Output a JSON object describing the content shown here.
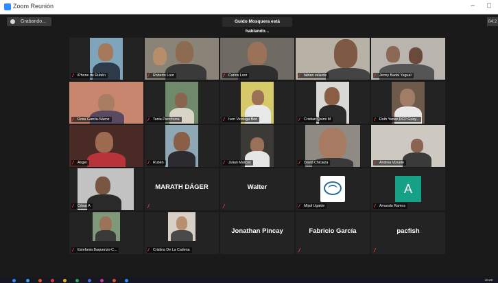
{
  "window": {
    "title": "Zoom Reunión",
    "minimize": "–",
    "maximize": "□"
  },
  "top": {
    "recording": "Grabando...",
    "speaking": "Guido Mosquera está hablando...",
    "timer": "04:2"
  },
  "participants": [
    {
      "name": "iPhone de Rubén",
      "label": ""
    },
    {
      "name": "Roberto Loor",
      "label": ""
    },
    {
      "name": "Carlos Loor",
      "label": ""
    },
    {
      "name": "fabian velarde",
      "label": ""
    },
    {
      "name": "Jenny Badal Yagual",
      "label": ""
    },
    {
      "name": "Rosa García-Sáenz",
      "label": ""
    },
    {
      "name": "Tania Parrchona",
      "label": ""
    },
    {
      "name": "Ivon Verduga Boo",
      "label": ""
    },
    {
      "name": "Cristian Quimi M",
      "label": ""
    },
    {
      "name": "Ruth Yanez DCP Guay...",
      "label": ""
    },
    {
      "name": "Angel",
      "label": ""
    },
    {
      "name": "Rubén",
      "label": ""
    },
    {
      "name": "Julian Marcos",
      "label": ""
    },
    {
      "name": "David Chicaiza",
      "label": ""
    },
    {
      "name": "Andrea Vizuete",
      "label": ""
    },
    {
      "name": "César A",
      "label": ""
    },
    {
      "name": "",
      "label": "MARATH DÁGER"
    },
    {
      "name": "",
      "label": "Walter"
    },
    {
      "name": "Mijail Ugalde",
      "label": ""
    },
    {
      "name": "Amanda Ramos",
      "label": "A"
    },
    {
      "name": "Estefania Baquerizo-C...",
      "label": ""
    },
    {
      "name": "Cristina De La Cadena",
      "label": ""
    },
    {
      "name": "",
      "label": "Jonathan Pincay"
    },
    {
      "name": "",
      "label": "Fabricio García"
    },
    {
      "name": "",
      "label": "pacfish"
    }
  ],
  "taskbar": {
    "clock": "16:28"
  },
  "colors": {
    "background": "#1a1a1a",
    "tile": "#232323",
    "accent": "#2d8cff",
    "mute": "#e53935"
  }
}
